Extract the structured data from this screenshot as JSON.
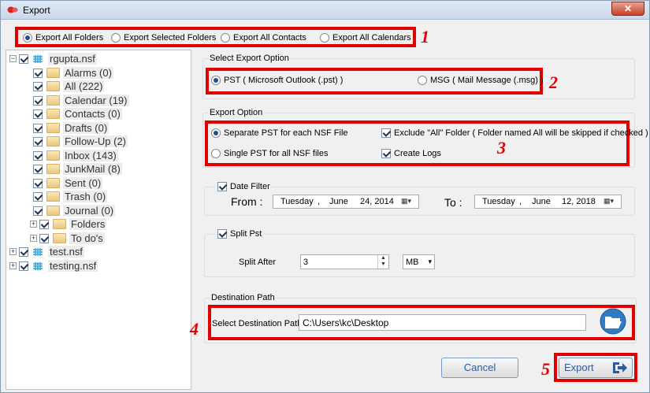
{
  "window": {
    "title": "Export"
  },
  "export_options": {
    "items": [
      {
        "label": "Export All Folders",
        "selected": true
      },
      {
        "label": "Export Selected Folders",
        "selected": false
      },
      {
        "label": "Export All Contacts",
        "selected": false
      },
      {
        "label": "Export All Calendars",
        "selected": false
      }
    ]
  },
  "annotations": [
    "1",
    "2",
    "3",
    "4",
    "5"
  ],
  "tree": {
    "root": "rgupta.nsf",
    "folders": [
      "Alarms (0)",
      "All (222)",
      "Calendar (19)",
      "Contacts (0)",
      "Drafts (0)",
      "Follow-Up (2)",
      "Inbox (143)",
      "JunkMail (8)",
      "Sent (0)",
      "Trash (0)",
      "Journal (0)",
      "Folders",
      "To do's"
    ],
    "others": [
      "test.nsf",
      "testing.nsf"
    ]
  },
  "select_export": {
    "title": "Select Export Option",
    "pst_label": "PST ( Microsoft Outlook (.pst) )",
    "msg_label": "MSG ( Mail Message (.msg) )",
    "selected": "pst"
  },
  "export_option": {
    "title": "Export Option",
    "separate_label": "Separate PST for each NSF File",
    "single_label": "Single PST for all NSF files",
    "exclude_label": "Exclude \"All\" Folder ( Folder named All will be skipped if checked )",
    "logs_label": "Create Logs"
  },
  "date_filter": {
    "title": "Date Filter",
    "from_label": "From :",
    "to_label": "To :",
    "from": {
      "day": "Tuesday",
      "sep": ",",
      "month": "June",
      "date": "24, 2014"
    },
    "to": {
      "day": "Tuesday",
      "sep": ",",
      "month": "June",
      "date": "12, 2018"
    }
  },
  "split_pst": {
    "title": "Split Pst",
    "after_label": "Split After",
    "value": "3",
    "unit": "MB"
  },
  "destination": {
    "title": "Destination Path",
    "label": "Select Destination Path",
    "value": "C:\\Users\\kc\\Desktop"
  },
  "buttons": {
    "cancel": "Cancel",
    "export": "Export"
  },
  "colors": {
    "annotation_red": "#e00000",
    "accent_blue": "#2b5c9c"
  }
}
